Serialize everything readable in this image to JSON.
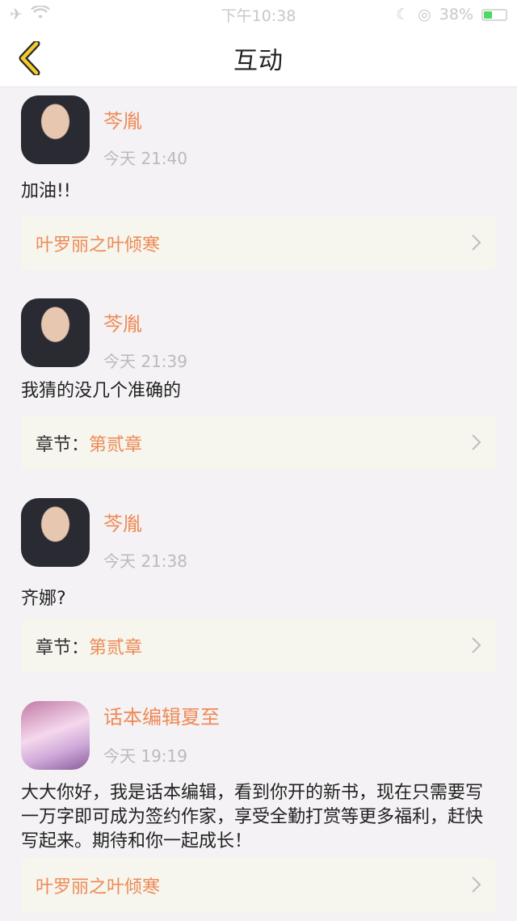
{
  "status_bar": {
    "time": "下午10:38",
    "battery": "38%",
    "battery_level": 0.38
  },
  "nav": {
    "title": "互动"
  },
  "items": [
    {
      "username": "芩胤",
      "time": "今天 21:40",
      "content": "加油!!",
      "link_prefix": "",
      "link_title": "叶罗丽之叶倾寒",
      "avatar": "boy"
    },
    {
      "username": "芩胤",
      "time": "今天 21:39",
      "content": "我猜的没几个准确的",
      "link_prefix": "章节：",
      "link_title": "第贰章",
      "avatar": "boy"
    },
    {
      "username": "芩胤",
      "time": "今天 21:38",
      "content": "齐娜?",
      "link_prefix": "章节：",
      "link_title": "第贰章",
      "avatar": "boy"
    },
    {
      "username": "话本编辑夏至",
      "time": "今天 19:19",
      "content": "大大你好，我是话本编辑，看到你开的新书，现在只需要写一万字即可成为签约作家，享受全勤打赏等更多福利，赶快写起来。期待和你一起成长！",
      "link_prefix": "",
      "link_title": "叶罗丽之叶倾寒",
      "avatar": "girl"
    }
  ]
}
